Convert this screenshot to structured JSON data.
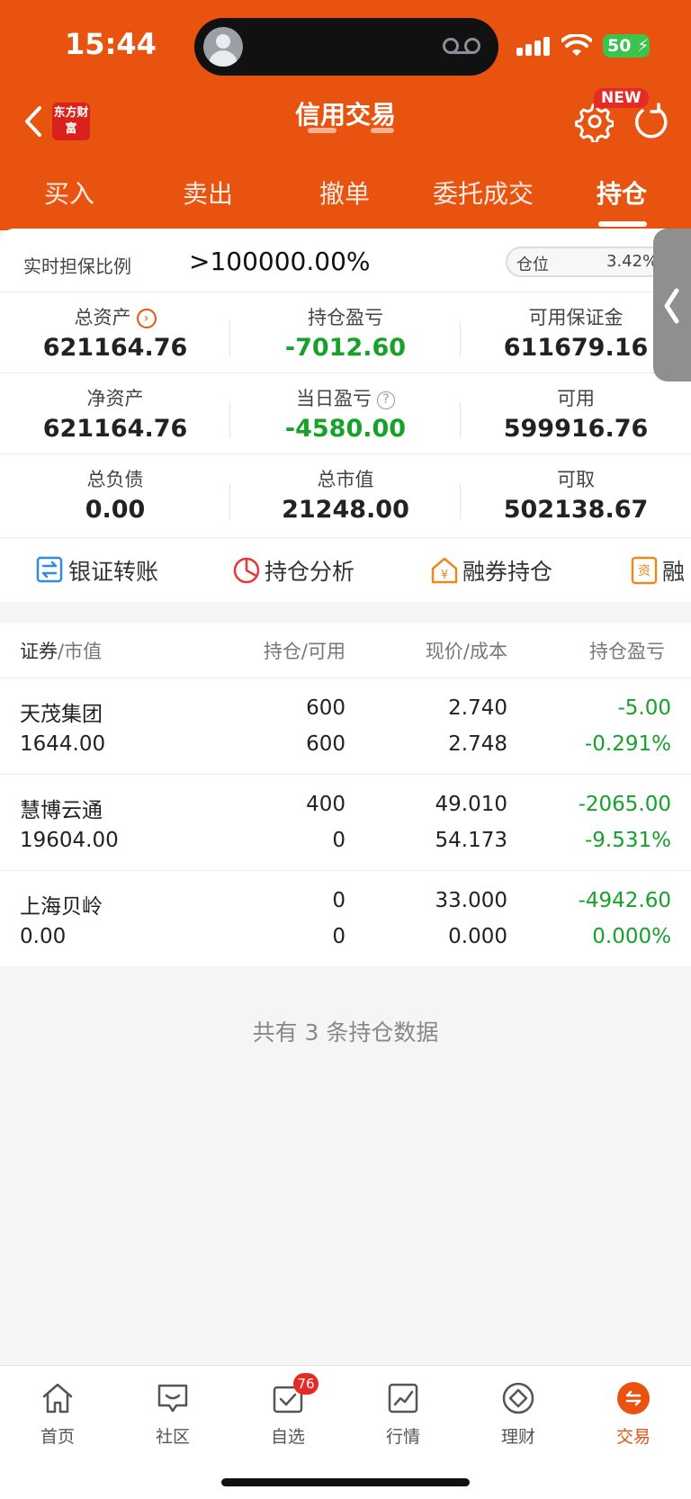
{
  "status_bar": {
    "time": "15:44",
    "battery": "50"
  },
  "header": {
    "logo_text": "东方财富",
    "title": "信用交易",
    "new_badge": "NEW"
  },
  "tabs": [
    {
      "label": "买入"
    },
    {
      "label": "卖出"
    },
    {
      "label": "撤单"
    },
    {
      "label": "委托成交"
    },
    {
      "label": "持仓"
    }
  ],
  "summary": {
    "ratio_label": "实时担保比例",
    "ratio_value": ">100000.00%",
    "position_label": "仓位",
    "position_value": "3.42%",
    "rows": [
      [
        {
          "label": "总资产",
          "value": "621164.76"
        },
        {
          "label": "持仓盈亏",
          "value": "-7012.60"
        },
        {
          "label": "可用保证金",
          "value": "611679.16"
        }
      ],
      [
        {
          "label": "净资产",
          "value": "621164.76"
        },
        {
          "label": "当日盈亏",
          "value": "-4580.00"
        },
        {
          "label": "可用",
          "value": "599916.76"
        }
      ],
      [
        {
          "label": "总负债",
          "value": "0.00"
        },
        {
          "label": "总市值",
          "value": "21248.00"
        },
        {
          "label": "可取",
          "value": "502138.67"
        }
      ]
    ]
  },
  "quick_actions": [
    {
      "label": "银证转账",
      "icon": "transfer-icon"
    },
    {
      "label": "持仓分析",
      "icon": "pie-chart-icon"
    },
    {
      "label": "融券持仓",
      "icon": "yen-house-icon"
    },
    {
      "label": "融",
      "icon": "资",
      "icon_name": "document-icon"
    }
  ],
  "table": {
    "headers": {
      "c1_a": "证券",
      "c1_b": "市值",
      "c2_a": "持仓",
      "c2_b": "可用",
      "c3_a": "现价",
      "c3_b": "成本",
      "c4": "持仓盈亏"
    },
    "rows": [
      {
        "name": "天茂集团",
        "market_value": "1644.00",
        "holding": "600",
        "available": "600",
        "price": "2.740",
        "cost": "2.748",
        "pnl": "-5.00",
        "pnl_pct": "-0.291%"
      },
      {
        "name": "慧博云通",
        "market_value": "19604.00",
        "holding": "400",
        "available": "0",
        "price": "49.010",
        "cost": "54.173",
        "pnl": "-2065.00",
        "pnl_pct": "-9.531%"
      },
      {
        "name": "上海贝岭",
        "market_value": "0.00",
        "holding": "0",
        "available": "0",
        "price": "33.000",
        "cost": "0.000",
        "pnl": "-4942.60",
        "pnl_pct": "0.000%"
      }
    ],
    "footer": "共有 3 条持仓数据"
  },
  "tabbar": [
    {
      "label": "首页",
      "icon": "home-icon"
    },
    {
      "label": "社区",
      "icon": "chat-icon"
    },
    {
      "label": "自选",
      "icon": "watchlist-icon",
      "badge": "76"
    },
    {
      "label": "行情",
      "icon": "market-chart-icon"
    },
    {
      "label": "理财",
      "icon": "diamond-icon"
    },
    {
      "label": "交易",
      "icon": "trade-icon",
      "active": true
    }
  ],
  "colors": {
    "brand": "#e8530f",
    "loss_green": "#16a12a",
    "badge_red": "#e52b26"
  }
}
